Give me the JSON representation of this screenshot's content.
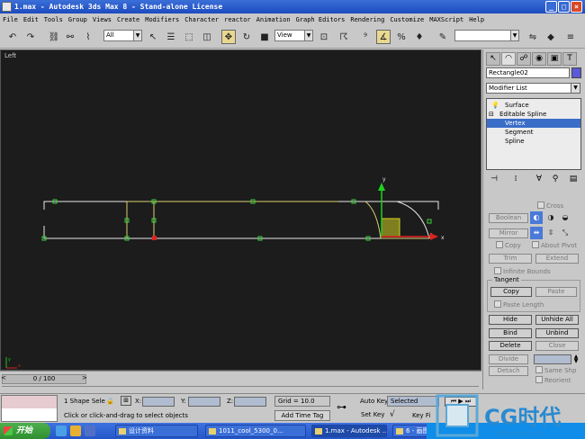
{
  "window": {
    "title": "1.max - Autodesk 3ds Max 8 - Stand-alone License"
  },
  "menu": [
    "File",
    "Edit",
    "Tools",
    "Group",
    "Views",
    "Create",
    "Modifiers",
    "Character",
    "reactor",
    "Animation",
    "Graph Editors",
    "Rendering",
    "Customize",
    "MAXScript",
    "Help"
  ],
  "toolbar": {
    "filter_value": "All",
    "refcoord_value": "View"
  },
  "viewport": {
    "label": "Left",
    "gizmo": {
      "x_label": "x",
      "y_label": "y"
    },
    "triad": {
      "x": "x",
      "y": "y"
    }
  },
  "panel": {
    "object_name": "Rectangle02",
    "object_color": "#5a5ad8",
    "modifier_list": "Modifier List",
    "stack": [
      {
        "label": "Surface"
      },
      {
        "label": "Editable Spline"
      },
      {
        "label": "Vertex"
      },
      {
        "label": "Segment"
      },
      {
        "label": "Spline"
      }
    ],
    "cross_label": "Cross",
    "buttons": {
      "boolean": "Boolean",
      "mirror": "Mirror",
      "copy_chk": "Copy",
      "about_pivot": "About Pivot",
      "trim": "Trim",
      "extend": "Extend",
      "infinite_bounds": "Infinite Bounds",
      "tangent_group": "Tangent",
      "copy": "Copy",
      "paste": "Paste",
      "paste_length": "Paste Length",
      "hide": "Hide",
      "unhide_all": "Unhide All",
      "bind": "Bind",
      "unbind": "Unbind",
      "delete": "Delete",
      "close": "Close",
      "divide": "Divide",
      "detach": "Detach",
      "same_shp": "Same Shp",
      "reorient": "Reorient"
    }
  },
  "timeline": {
    "frame": "0 / 100"
  },
  "status": {
    "selection": "1 Shape Sele",
    "prompt": "Click or click-and-drag to select objects",
    "x_label": "X:",
    "y_label": "Y:",
    "z_label": "Z:",
    "grid": "Grid = 10.0",
    "add_time_tag": "Add Time Tag",
    "auto_key": "Auto Key",
    "set_key": "Set Key",
    "key_filter": "Key Fi",
    "key_mode_value": "Selected"
  },
  "taskbar": {
    "start": "开始",
    "tasks": [
      "设计资料",
      "1011_cool_5300_0...",
      "1.max - Autodesk ...",
      "6 - 画图"
    ]
  },
  "colors": {
    "title_bar": "#2456c8",
    "viewport_bg": "#1c1c1c",
    "selection": "#3a6dc8",
    "taskbar": "#2456c8"
  }
}
